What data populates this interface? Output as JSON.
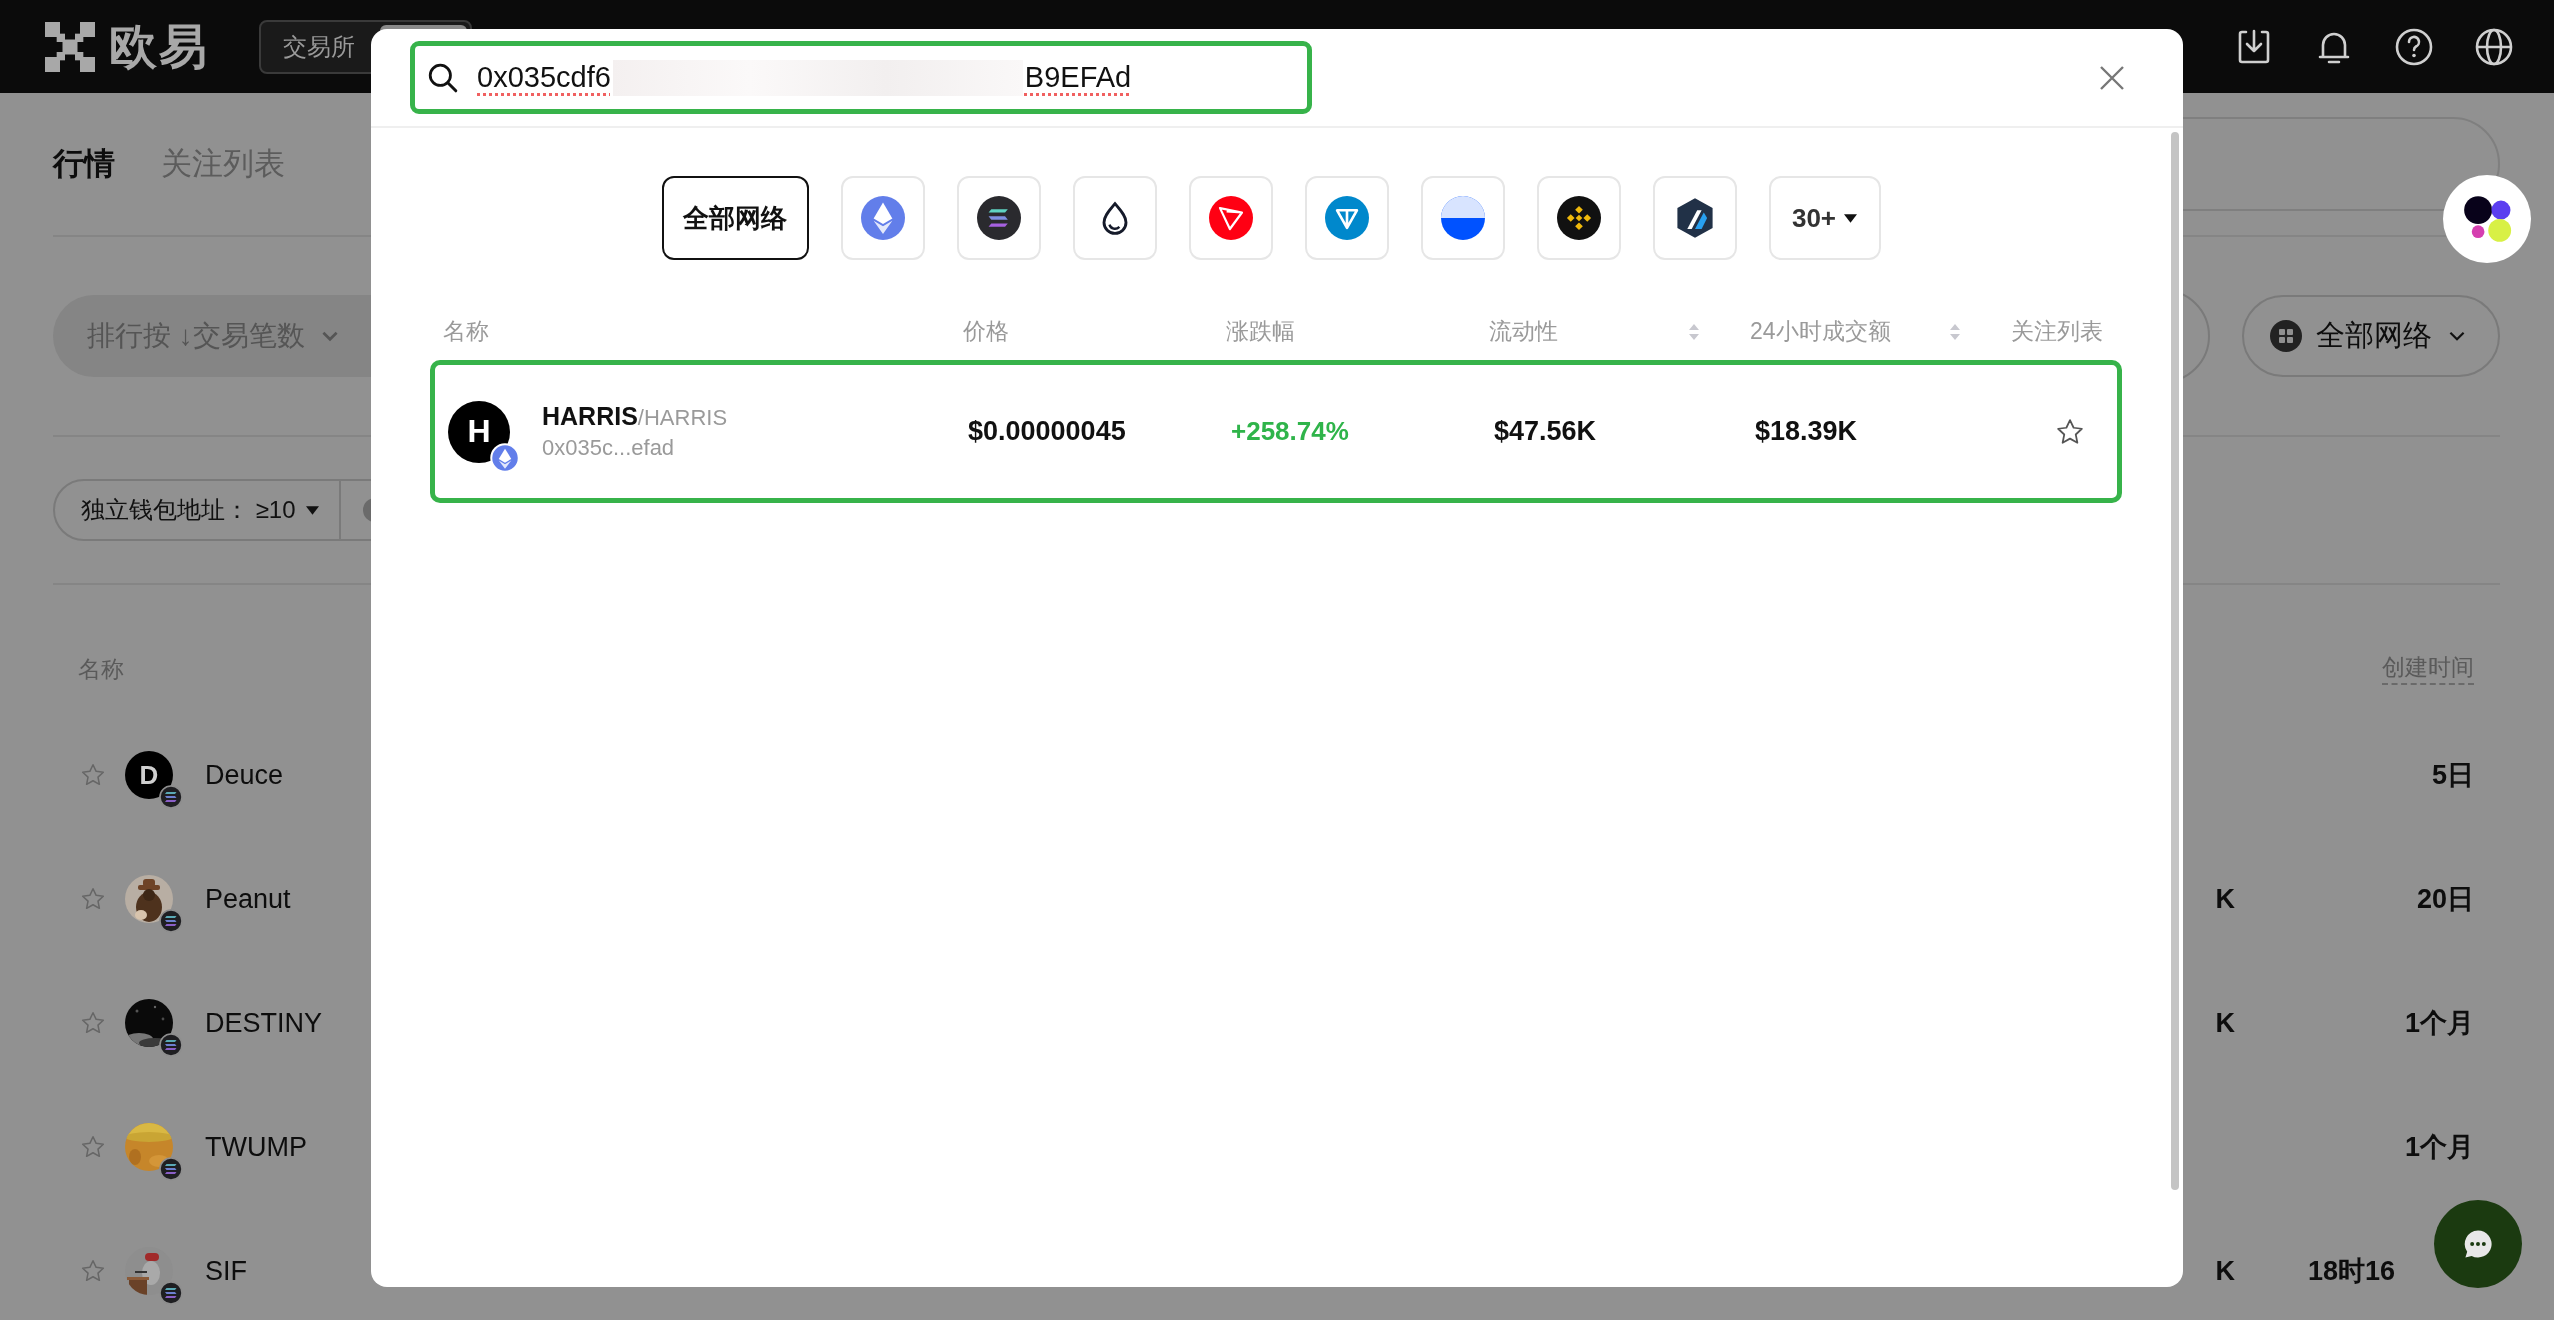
{
  "top_bar": {
    "logo_text": "欧易",
    "switch": [
      {
        "label": "交易所",
        "selected": false
      },
      {
        "selected": true
      }
    ]
  },
  "page_tabs": [
    {
      "label": "行情",
      "selected": true
    },
    {
      "label": "关注列表",
      "selected": false
    }
  ],
  "sort_button": {
    "label": "排行按 ↓交易笔数"
  },
  "network_button": {
    "label": "全部网络"
  },
  "filters": [
    {
      "label": "独立钱包地址：",
      "value": "≥10"
    }
  ],
  "list": {
    "columns": [
      "名称",
      "创建时间"
    ],
    "rows": [
      {
        "name": "Deuce",
        "avatar": {
          "kind": "letter",
          "letter": "D"
        },
        "starred": false,
        "created": "5日",
        "cut": false
      },
      {
        "name": "Peanut",
        "starred": false,
        "column_partial": "K",
        "created": "20日",
        "cut": false
      },
      {
        "name": "DESTINY",
        "starred": false,
        "column_partial": "K",
        "created": "1个月",
        "cut": false
      },
      {
        "name": "TWUMP",
        "starred": false,
        "created": "1个月",
        "cut": false
      },
      {
        "name": "SIF",
        "starred": false,
        "column_partial": "K",
        "created": "18时16",
        "cut": true
      }
    ]
  },
  "modal": {
    "search": {
      "value_start": "0x035cdf6",
      "value_end": "B9EFAd"
    },
    "networks": [
      {
        "kind": "all",
        "label": "全部网络",
        "selected": true
      },
      {
        "kind": "icon",
        "selected": false
      },
      {
        "kind": "icon",
        "selected": false
      },
      {
        "kind": "icon",
        "selected": false
      },
      {
        "kind": "icon",
        "selected": false
      },
      {
        "kind": "icon",
        "selected": false
      },
      {
        "kind": "icon",
        "selected": false
      },
      {
        "kind": "icon",
        "selected": false
      },
      {
        "kind": "icon",
        "selected": false
      },
      {
        "kind": "more",
        "label": "30+",
        "selected": false
      }
    ],
    "columns": [
      {
        "label": "名称",
        "sortable": false
      },
      {
        "label": "价格",
        "sortable": false
      },
      {
        "label": "涨跌幅",
        "sortable": false
      },
      {
        "label": "流动性",
        "sortable": true
      },
      {
        "label": "24小时成交额",
        "sortable": true
      },
      {
        "label": "关注列表",
        "sortable": false
      }
    ],
    "results": [
      {
        "letter": "H",
        "symbol": "HARRIS",
        "pair": "/HARRIS",
        "address": "0x035c...efad",
        "price": "$0.00000045",
        "change": "+258.74%",
        "liquidity": "$47.56K",
        "volume": "$18.39K",
        "starred": false,
        "highlighted": true
      }
    ]
  }
}
